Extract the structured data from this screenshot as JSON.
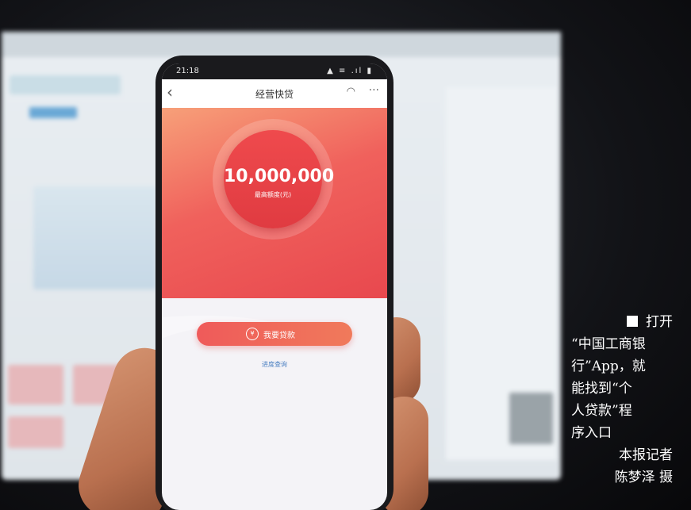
{
  "phone": {
    "status_time": "21:18",
    "status_icons": "▲ ≡ .ıl ▮",
    "app_title": "经营快贷",
    "max_amount": "10,000,000",
    "max_amount_label": "最高额度(元)",
    "loan_button": "我要贷款",
    "loan_icon": "¥",
    "progress_link": "进度查询"
  },
  "caption": {
    "lines": [
      "打开",
      "“中国工商银",
      "行”App，就",
      "能找到“个",
      "人贷款”程",
      "序入口"
    ],
    "credit_line1": "本报记者",
    "credit_line2": "陈梦泽 摄"
  }
}
